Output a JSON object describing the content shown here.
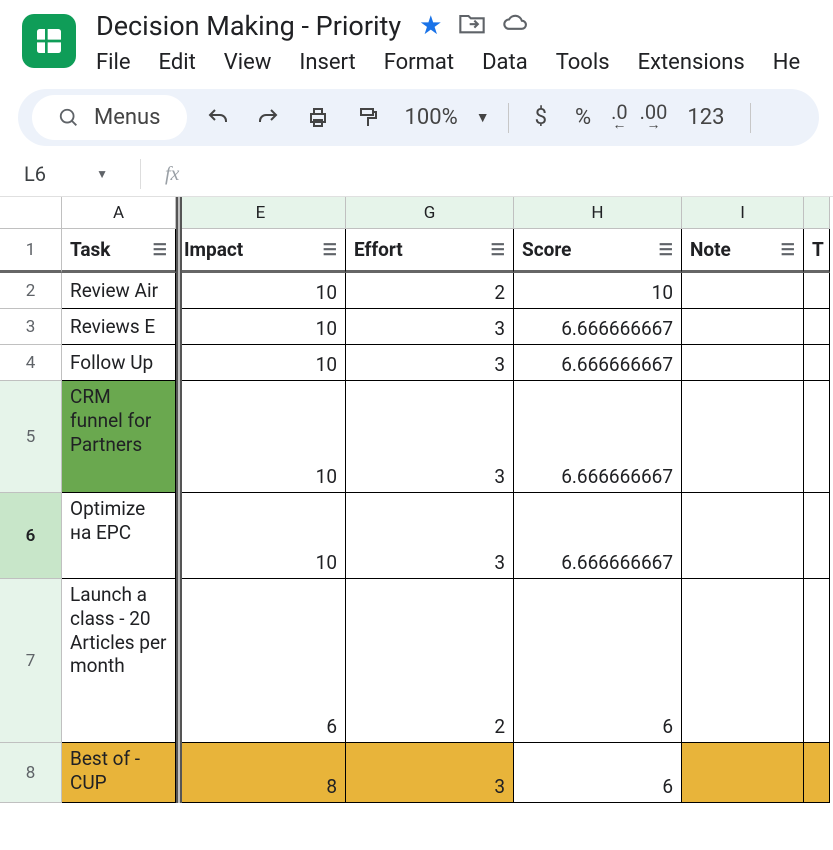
{
  "header": {
    "title": "Decision Making - Priority",
    "menubar": [
      "File",
      "Edit",
      "View",
      "Insert",
      "Format",
      "Data",
      "Tools",
      "Extensions",
      "He"
    ]
  },
  "toolbar": {
    "menus_label": "Menus",
    "zoom": "100%",
    "currency": "$",
    "percent": "%",
    "dec_less": ".0",
    "dec_more": ".00",
    "numfmt123": "123"
  },
  "formula_bar": {
    "name_box": "L6",
    "fx": "fx"
  },
  "columns": {
    "A": "A",
    "E": "E",
    "G": "G",
    "H": "H",
    "I": "I"
  },
  "headers": {
    "task": "Task",
    "impact": "Impact",
    "effort": "Effort",
    "score": "Score",
    "note": "Note",
    "colJ": "T"
  },
  "rows": [
    {
      "n": "1"
    },
    {
      "n": "2",
      "task": "Review Air",
      "impact": "10",
      "effort": "2",
      "score": "10",
      "note": ""
    },
    {
      "n": "3",
      "task": "Reviews E",
      "impact": "10",
      "effort": "3",
      "score": "6.666666667",
      "note": ""
    },
    {
      "n": "4",
      "task": "Follow Up",
      "impact": "10",
      "effort": "3",
      "score": "6.666666667",
      "note": ""
    },
    {
      "n": "5",
      "task": "CRM funnel for Partners",
      "impact": "10",
      "effort": "3",
      "score": "6.666666667",
      "note": ""
    },
    {
      "n": "6",
      "task": "Optimize на EPC",
      "impact": "10",
      "effort": "3",
      "score": "6.666666667",
      "note": ""
    },
    {
      "n": "7",
      "task": "Launch a class - 20 Articles per month",
      "impact": "6",
      "effort": "2",
      "score": "6",
      "note": ""
    },
    {
      "n": "8",
      "task": "Best of - CUP",
      "impact": "8",
      "effort": "3",
      "score": "6",
      "note": ""
    }
  ]
}
